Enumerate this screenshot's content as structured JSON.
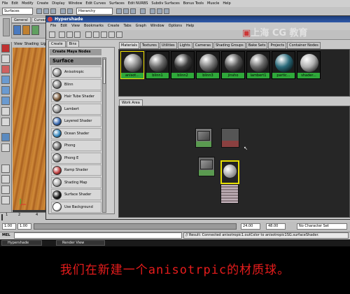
{
  "maya": {
    "menu": [
      "File",
      "Edit",
      "Modify",
      "Create",
      "Display",
      "Window",
      "Edit Curves",
      "Surfaces",
      "Edit NURBS",
      "Subdiv Surfaces",
      "Bonus Tools",
      "Muscle",
      "Help"
    ],
    "mode_select": "Surfaces",
    "hierarchy_field": "Hierarchy",
    "shelf_tabs": [
      "General",
      "Curves"
    ],
    "viewport_menu": [
      "View",
      "Shading",
      "Lig"
    ],
    "timeline_ticks": [
      "1",
      "2",
      "4",
      "6",
      "8"
    ],
    "range": {
      "start": "1.00",
      "start_inner": "1.00",
      "end_inner": "24.00",
      "end": "48.00",
      "character_set": "No Character Set"
    },
    "command_label": "MEL",
    "result_text": "// Result: Connected anisotropic1.outColor to anisotropic1SG.surfaceShader."
  },
  "taskbar": {
    "items": [
      "Hypershade",
      "Render View"
    ]
  },
  "hypershade": {
    "title": "Hypershade",
    "menu": [
      "File",
      "Edit",
      "View",
      "Bookmarks",
      "Create",
      "Tabs",
      "Graph",
      "Window",
      "Options",
      "Help"
    ],
    "create_tabs": [
      "Create",
      "Bins"
    ],
    "create_header": "Create Maya Nodes",
    "section_header": "Surface",
    "nodes": [
      {
        "label": "Anisotropic",
        "color": "#9a9a9a"
      },
      {
        "label": "Blinn",
        "color": "#8a8a8a"
      },
      {
        "label": "Hair Tube Shader",
        "color": "#7a5a3a"
      },
      {
        "label": "Lambert",
        "color": "#9c9c9c"
      },
      {
        "label": "Layered Shader",
        "color": "#3a6ab0"
      },
      {
        "label": "Ocean Shader",
        "color": "#3a8ac0"
      },
      {
        "label": "Phong",
        "color": "#707070"
      },
      {
        "label": "Phong E",
        "color": "#909090"
      },
      {
        "label": "Ramp Shader",
        "color": "#c04040"
      },
      {
        "label": "Shading Map",
        "color": "#b0b0b0"
      },
      {
        "label": "Surface Shader",
        "color": "#1a1a1a"
      },
      {
        "label": "Use Background",
        "color": "#ffffff"
      }
    ],
    "material_tabs": [
      "Materials",
      "Textures",
      "Utilities",
      "Lights",
      "Cameras",
      "Shading Groups",
      "Bake Sets",
      "Projects",
      "Container Nodes"
    ],
    "active_material_tab": "Materials",
    "materials": [
      {
        "label": "anisot...",
        "color": "#8a8a8a"
      },
      {
        "label": "blinn1",
        "color": "#6a6a6a"
      },
      {
        "label": "blinn2",
        "color": "#3a3a3a"
      },
      {
        "label": "blinn3",
        "color": "#7a7a7a"
      },
      {
        "label": "jinsho",
        "color": "#555555"
      },
      {
        "label": "lambert1",
        "color": "#6a6a6a"
      },
      {
        "label": "partic...",
        "color": "#2a6a7a"
      },
      {
        "label": "shader...",
        "color": "#b0b0b0"
      }
    ],
    "work_area_tab": "Work Area",
    "work_nodes": [
      "anisotropic1",
      "anisotropic1SG",
      "lambert1",
      "blinn1"
    ]
  },
  "watermark": {
    "text": "上海 CG 教育",
    "sub": "Shanghai computer graphics"
  },
  "caption": "我们在新建一个anisotrpic的材质球。"
}
